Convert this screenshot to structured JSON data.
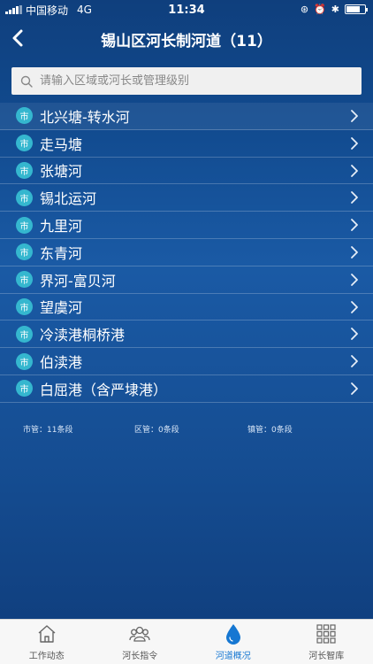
{
  "status": {
    "carrier": "中国移动",
    "network": "4G",
    "time": "11:34"
  },
  "nav": {
    "title": "锡山区河长制河道（11）"
  },
  "search": {
    "placeholder": "请输入区域或河长或管理级别",
    "value": ""
  },
  "badge_text": "市",
  "rivers": [
    {
      "label": "北兴塘-转水河"
    },
    {
      "label": "走马塘"
    },
    {
      "label": "张塘河"
    },
    {
      "label": "锡北运河"
    },
    {
      "label": "九里河"
    },
    {
      "label": "东青河"
    },
    {
      "label": "界河-富贝河"
    },
    {
      "label": "望虞河"
    },
    {
      "label": "冷渎港桐桥港"
    },
    {
      "label": "伯渎港"
    },
    {
      "label": "白屈港（含严埭港）"
    }
  ],
  "summary": {
    "city": "市管：11条段",
    "district": "区管：0条段",
    "town": "镇管：0条段"
  },
  "tabs": [
    {
      "label": "工作动态",
      "icon": "home-icon",
      "active": false
    },
    {
      "label": "河长指令",
      "icon": "people-icon",
      "active": false
    },
    {
      "label": "河道概况",
      "icon": "water-drop-icon",
      "active": true
    },
    {
      "label": "河长智库",
      "icon": "grid-icon",
      "active": false
    }
  ],
  "colors": {
    "accent": "#1677d2",
    "badge": "#35b7cf"
  }
}
